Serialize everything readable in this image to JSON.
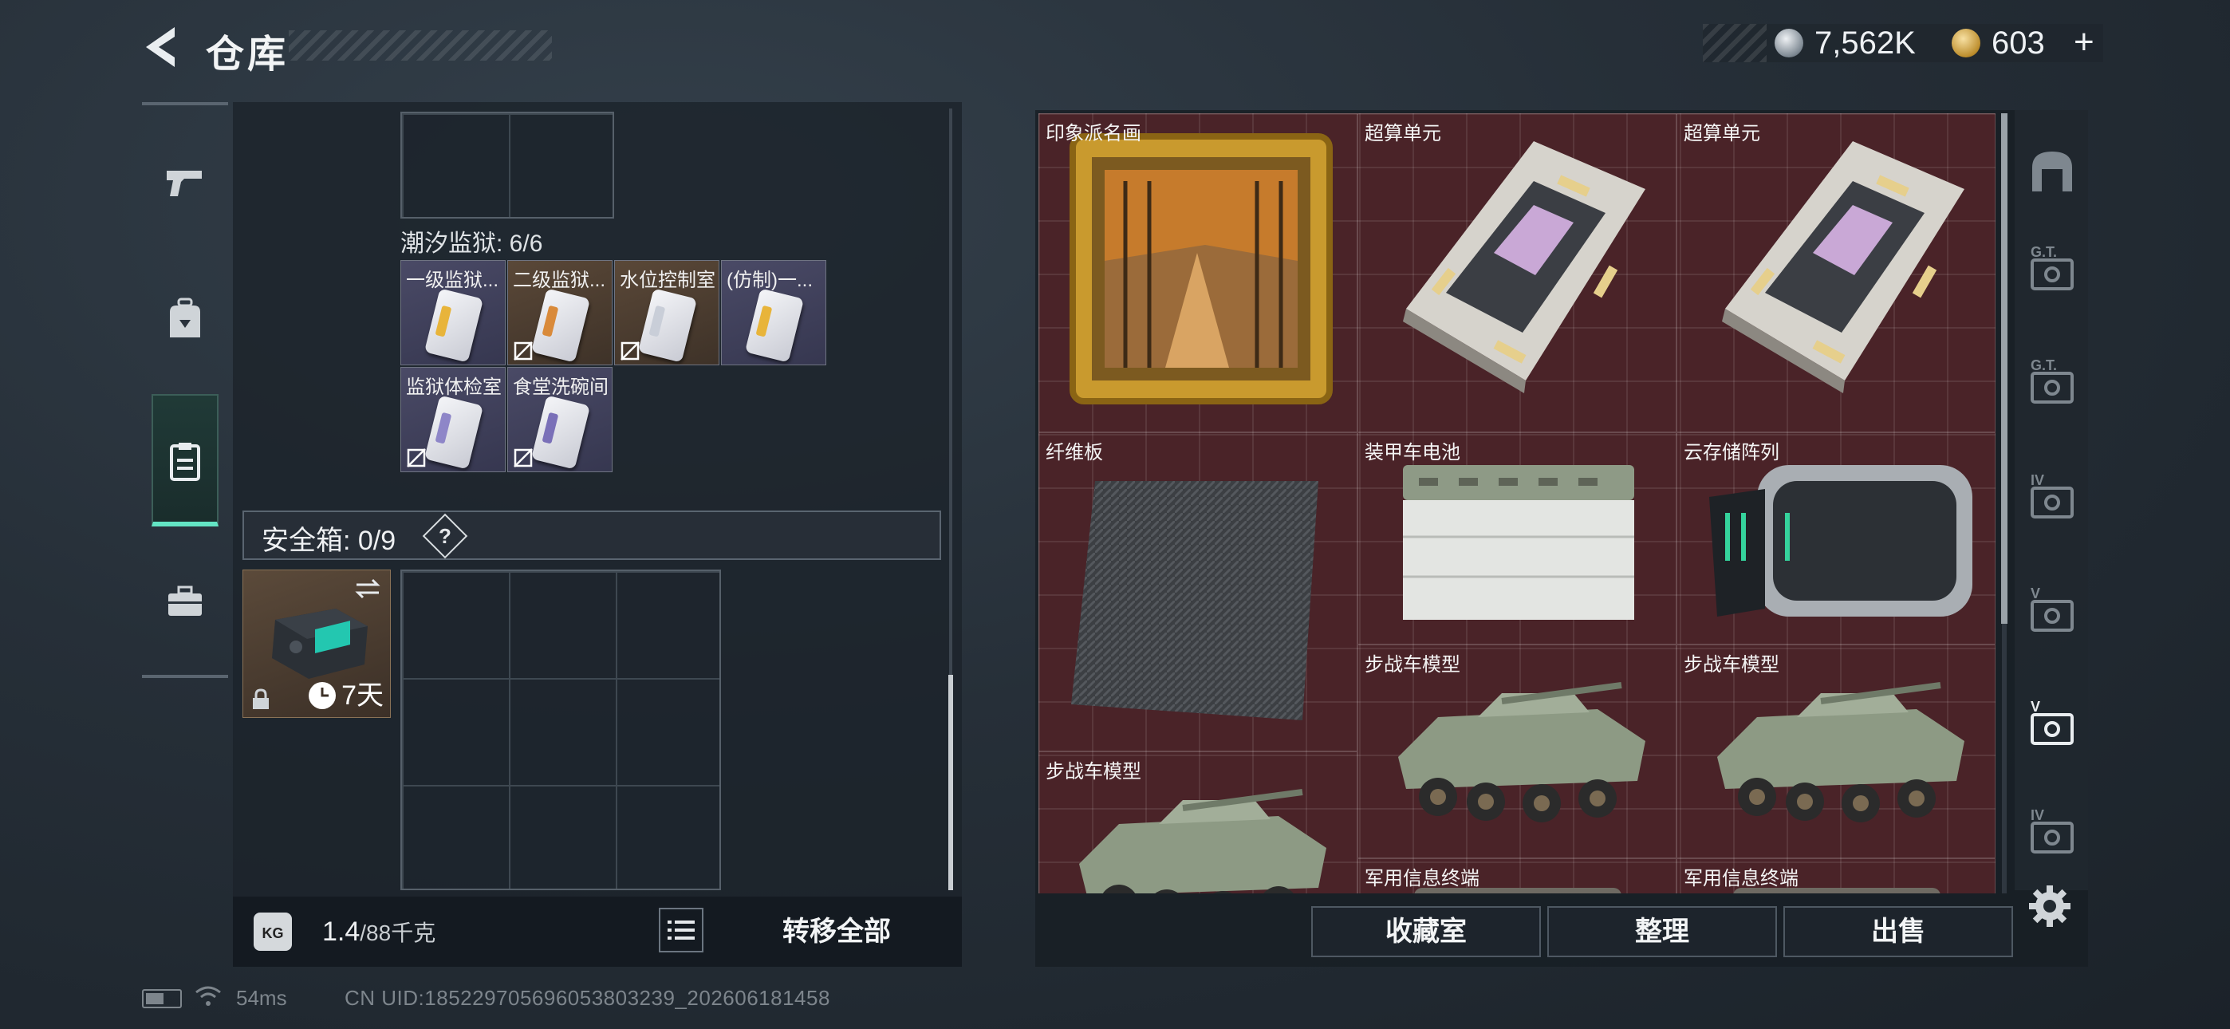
{
  "header": {
    "title": "仓库",
    "back_icon": "back-arrow-icon"
  },
  "currency": {
    "silver": "7,562K",
    "gold": "603",
    "plus": "+"
  },
  "sidebar": {
    "items": [
      {
        "name": "weapons",
        "icon": "pistol-icon"
      },
      {
        "name": "equipment",
        "icon": "backpack-icon"
      },
      {
        "name": "storage",
        "icon": "clipboard-icon",
        "active": true
      },
      {
        "name": "case",
        "icon": "briefcase-icon"
      }
    ]
  },
  "prison": {
    "label": "潮汐监狱: 6/6",
    "cards": [
      {
        "name": "一级监狱...",
        "stripe": "#e8b43a",
        "bg": "purple",
        "no_sell": false
      },
      {
        "name": "二级监狱...",
        "stripe": "#d98a3a",
        "bg": "brown",
        "no_sell": true
      },
      {
        "name": "水位控制室",
        "stripe": "#c9ced8",
        "bg": "brown",
        "no_sell": true
      },
      {
        "name": "(仿制)一...",
        "stripe": "#e8b43a",
        "bg": "purple",
        "no_sell": false
      },
      {
        "name": "监狱体检室",
        "stripe": "#8e86c8",
        "bg": "purple",
        "no_sell": true
      },
      {
        "name": "食堂洗碗间",
        "stripe": "#7a70b8",
        "bg": "purple",
        "no_sell": true
      }
    ]
  },
  "safe": {
    "label": "安全箱: 0/9",
    "help": "?",
    "days": "7天"
  },
  "footer_left": {
    "weight": "1.4",
    "weight_max": "/88千克",
    "kg_label": "KG",
    "transfer": "转移全部"
  },
  "storage": {
    "items": [
      {
        "name": "印象派名画",
        "kind": "painting"
      },
      {
        "name": "超算单元",
        "kind": "board"
      },
      {
        "name": "超算单元",
        "kind": "board"
      },
      {
        "name": "纤维板",
        "kind": "carbon"
      },
      {
        "name": "装甲车电池",
        "kind": "battery"
      },
      {
        "name": "云存储阵列",
        "kind": "server"
      },
      {
        "name": "步战车模型",
        "kind": "ifv"
      },
      {
        "name": "步战车模型",
        "kind": "ifv"
      },
      {
        "name": "步战车模型",
        "kind": "ifv"
      },
      {
        "name": "军用信息终端",
        "kind": "terminal"
      },
      {
        "name": "军用信息终端",
        "kind": "terminal"
      }
    ]
  },
  "actions": {
    "collection": "收藏室",
    "sort": "整理",
    "sell": "出售"
  },
  "right_rail": {
    "labels": [
      "",
      "G.T.",
      "G.T.",
      "IV",
      "V",
      "V",
      "IV"
    ]
  },
  "status": {
    "ping": "54ms",
    "uid": "CN UID:185229705696053803239_202606181458"
  }
}
